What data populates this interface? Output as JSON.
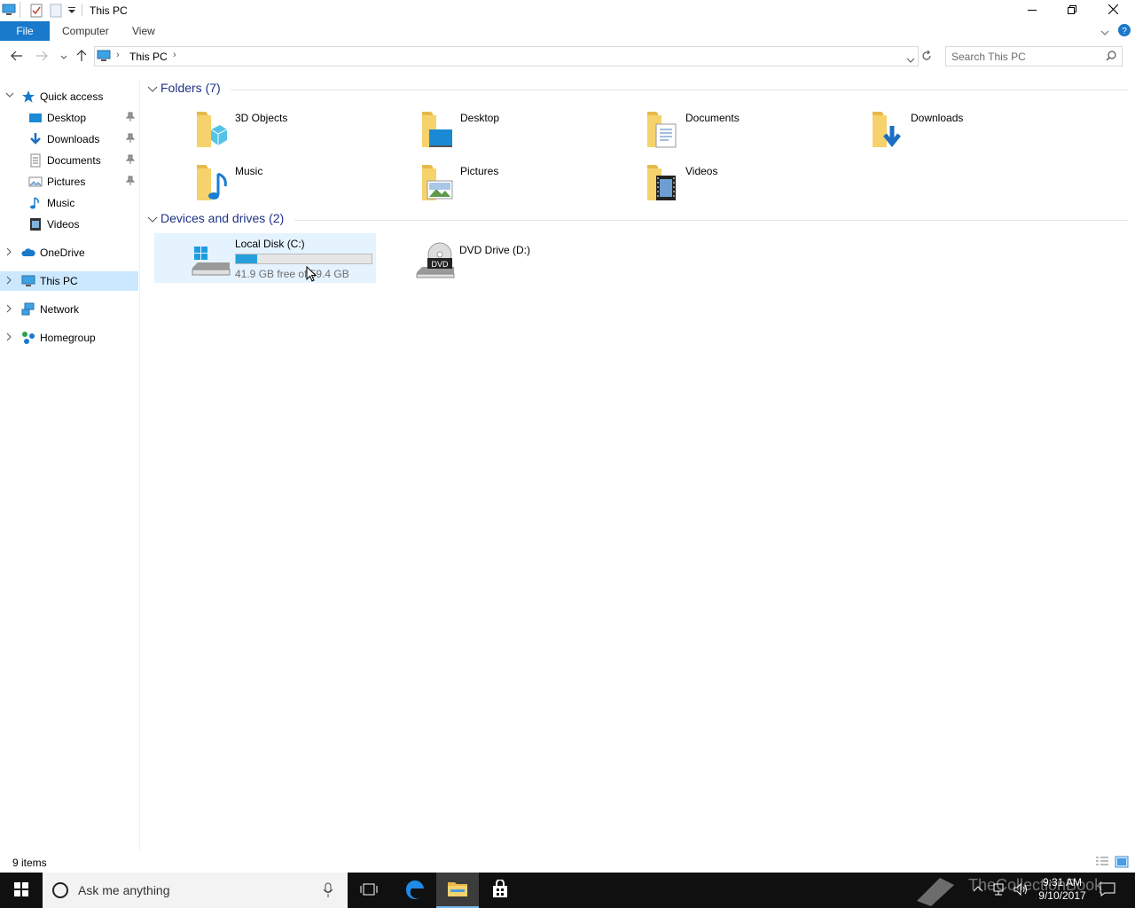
{
  "window": {
    "title": "This PC",
    "minimize_icon": "minimize-icon",
    "maximize_icon": "restore-icon",
    "close_icon": "close-icon"
  },
  "ribbon": {
    "tabs": [
      {
        "label": "File"
      },
      {
        "label": "Computer"
      },
      {
        "label": "View"
      }
    ]
  },
  "address": {
    "path": [
      "This PC"
    ],
    "search_placeholder": "Search This PC"
  },
  "nav": {
    "items": [
      {
        "label": "Quick access",
        "icon": "star-icon"
      },
      {
        "label": "Desktop",
        "icon": "desktop-icon",
        "pinned": true
      },
      {
        "label": "Downloads",
        "icon": "download-icon",
        "pinned": true
      },
      {
        "label": "Documents",
        "icon": "document-icon",
        "pinned": true
      },
      {
        "label": "Pictures",
        "icon": "pictures-icon",
        "pinned": true
      },
      {
        "label": "Music",
        "icon": "music-icon"
      },
      {
        "label": "Videos",
        "icon": "video-icon"
      },
      {
        "label": "OneDrive",
        "icon": "cloud-icon"
      },
      {
        "label": "This PC",
        "icon": "computer-icon",
        "selected": true
      },
      {
        "label": "Network",
        "icon": "network-icon"
      },
      {
        "label": "Homegroup",
        "icon": "homegroup-icon"
      }
    ]
  },
  "folders": {
    "header": "Folders (7)",
    "items": [
      {
        "label": "3D Objects"
      },
      {
        "label": "Desktop"
      },
      {
        "label": "Documents"
      },
      {
        "label": "Downloads"
      },
      {
        "label": "Music"
      },
      {
        "label": "Pictures"
      },
      {
        "label": "Videos"
      }
    ]
  },
  "drives": {
    "header": "Devices and drives (2)",
    "items": [
      {
        "label": "Local Disk (C:)",
        "space": "41.9 GB free of 59.4 GB",
        "used_fraction": 0.155
      },
      {
        "label": "DVD Drive (D:)"
      }
    ]
  },
  "status": {
    "count": "9 items"
  },
  "taskbar": {
    "search_text": "Ask me anything",
    "time": "9:31 AM",
    "date": "9/10/2017",
    "watermark": "TheCollectionBook"
  },
  "colors": {
    "accent": "#1979ca",
    "selection": "#cce8ff",
    "drive_bar": "#26a0da"
  }
}
